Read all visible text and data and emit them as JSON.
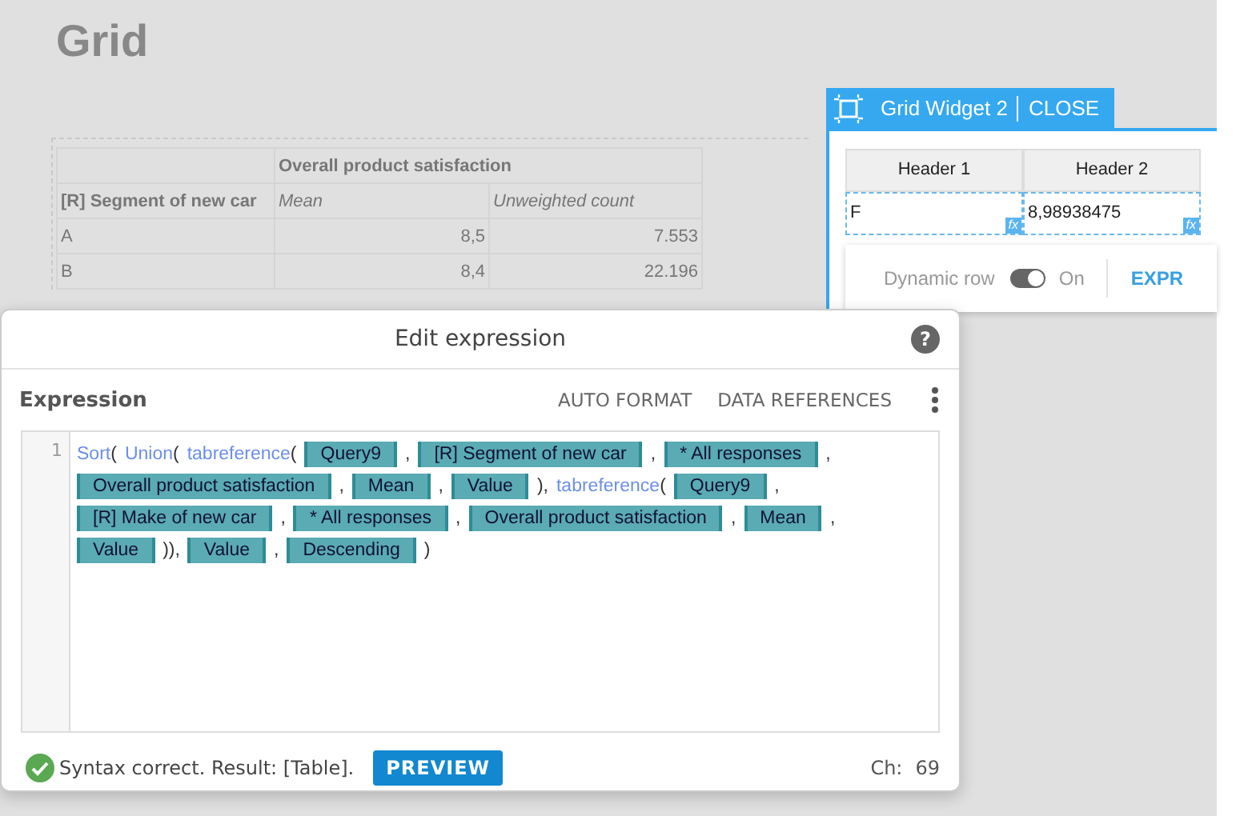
{
  "page": {
    "title": "Grid"
  },
  "table": {
    "group_header": "Overall product satisfaction",
    "columns": [
      "[R] Segment of new car",
      "Mean",
      "Unweighted count"
    ],
    "rows": [
      [
        "A",
        "8,5",
        "7.553"
      ],
      [
        "B",
        "8,4",
        "22.196"
      ]
    ]
  },
  "widget": {
    "title": "Grid Widget 2",
    "close": "CLOSE",
    "headers": [
      "Header 1",
      "Header 2"
    ],
    "cells": [
      {
        "value": "F",
        "badge": "fx"
      },
      {
        "value": "8,98938475",
        "badge": "fx"
      }
    ],
    "toggle_label": "Dynamic row",
    "toggle_on": true,
    "toggle_state": "On",
    "expr": "EXPR"
  },
  "dialog": {
    "title": "Edit expression",
    "help": "?",
    "section": "Expression",
    "actions": [
      "AUTO FORMAT",
      "DATA REFERENCES"
    ],
    "line_number": "1",
    "lines": [
      [
        {
          "kind": "fn",
          "text": "Sort"
        },
        {
          "kind": "text",
          "text": "("
        },
        {
          "kind": "fn",
          "text": "Union"
        },
        {
          "kind": "text",
          "text": "("
        },
        {
          "kind": "fn",
          "text": "tabreference"
        },
        {
          "kind": "text",
          "text": "("
        },
        {
          "kind": "ref",
          "text": "Query9"
        },
        {
          "kind": "text",
          "text": ","
        },
        {
          "kind": "ref",
          "text": "[R] Segment of new car"
        },
        {
          "kind": "text",
          "text": ","
        },
        {
          "kind": "ref",
          "text": "* All responses"
        },
        {
          "kind": "text",
          "text": ","
        }
      ],
      [
        {
          "kind": "ref",
          "text": "Overall product satisfaction"
        },
        {
          "kind": "text",
          "text": ","
        },
        {
          "kind": "ref",
          "text": "Mean"
        },
        {
          "kind": "text",
          "text": ","
        },
        {
          "kind": "ref",
          "text": "Value"
        },
        {
          "kind": "text",
          "text": "),"
        },
        {
          "kind": "fn",
          "text": "tabreference"
        },
        {
          "kind": "text",
          "text": "("
        },
        {
          "kind": "ref",
          "text": "Query9"
        },
        {
          "kind": "text",
          "text": ","
        }
      ],
      [
        {
          "kind": "ref",
          "text": "[R] Make of new car"
        },
        {
          "kind": "text",
          "text": ","
        },
        {
          "kind": "ref",
          "text": "* All responses"
        },
        {
          "kind": "text",
          "text": ","
        },
        {
          "kind": "ref",
          "text": "Overall product satisfaction"
        },
        {
          "kind": "text",
          "text": ","
        },
        {
          "kind": "ref",
          "text": "Mean"
        },
        {
          "kind": "text",
          "text": ","
        }
      ],
      [
        {
          "kind": "ref",
          "text": "Value"
        },
        {
          "kind": "text",
          "text": ")),"
        },
        {
          "kind": "ref",
          "text": "Value"
        },
        {
          "kind": "text",
          "text": ","
        },
        {
          "kind": "ref",
          "text": "Descending"
        },
        {
          "kind": "text",
          "text": ")"
        }
      ]
    ],
    "status": "Syntax correct. Result: [Table].",
    "preview": "PREVIEW",
    "count_label": "Ch:",
    "count": "69"
  }
}
